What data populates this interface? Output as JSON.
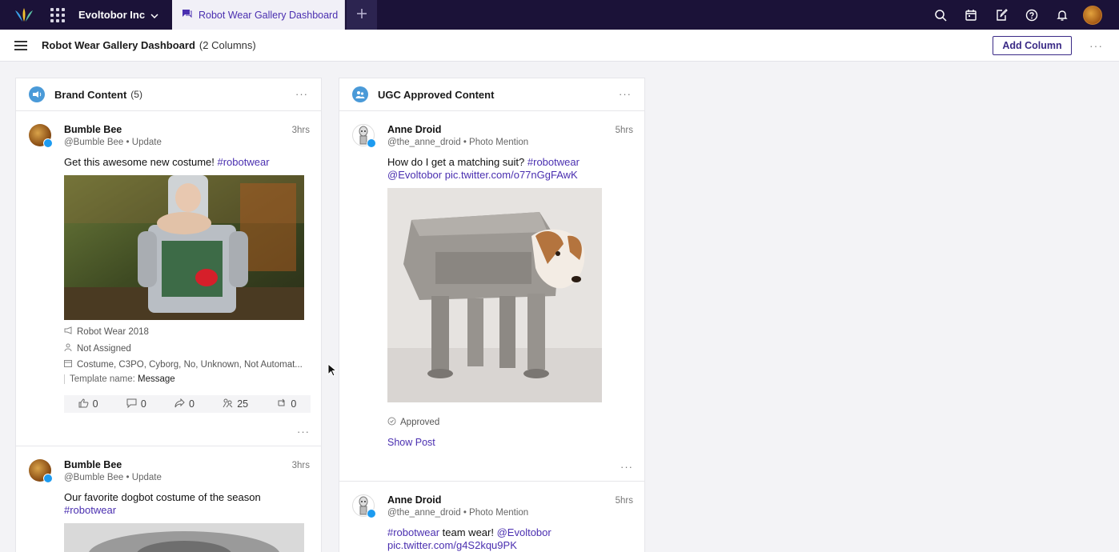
{
  "topbar": {
    "org_name": "Evoltobor Inc",
    "active_tab": "Robot Wear Gallery Dashboard",
    "icons": [
      "logo-icon",
      "apps-grid-icon",
      "chevron-down-icon",
      "chat-icon",
      "plus-icon",
      "search-icon",
      "calendar-icon",
      "compose-icon",
      "help-icon",
      "bell-icon",
      "avatar"
    ]
  },
  "header": {
    "title": "Robot Wear Gallery Dashboard",
    "subtitle": "(2 Columns)",
    "add_column_label": "Add Column",
    "more": "···"
  },
  "columns": [
    {
      "title": "Brand Content",
      "count": "(5)",
      "more": "···",
      "posts": [
        {
          "author": "Bumble Bee",
          "handle": "@Bumble Bee",
          "type": "Update",
          "time": "3hrs",
          "text": "Get this awesome new costume!",
          "hashtag": "#robotwear",
          "campaign": "Robot Wear 2018",
          "assignment": "Not Assigned",
          "tags": "Costume, C3PO, Cyborg, No, Unknown, Not Automat...",
          "template_label": "Template name:",
          "template_value": "Message",
          "stats": {
            "likes": "0",
            "comments": "0",
            "shares": "0",
            "reach": "25",
            "retweets": "0"
          }
        },
        {
          "author": "Bumble Bee",
          "handle": "@Bumble Bee",
          "type": "Update",
          "time": "3hrs",
          "text": "Our favorite dogbot costume of the season",
          "hashtag": "#robotwear"
        }
      ]
    },
    {
      "title": "UGC Approved Content",
      "more": "···",
      "posts": [
        {
          "author": "Anne Droid",
          "handle": "@the_anne_droid",
          "type": "Photo Mention",
          "time": "5hrs",
          "text": "How do I get a matching suit?",
          "hashtag": "#robotwear",
          "mention": "@Evoltobor",
          "url": "pic.twitter.com/o77nGgFAwK",
          "status": "Approved",
          "show_post": "Show Post"
        },
        {
          "author": "Anne Droid",
          "handle": "@the_anne_droid",
          "type": "Photo Mention",
          "time": "5hrs",
          "hashtag": "#robotwear",
          "text": "team wear!",
          "mention": "@Evoltobor",
          "url": "pic.twitter.com/g4S2kqu9PK"
        }
      ]
    }
  ],
  "separator": "•",
  "colors": {
    "topbar": "#1b1238",
    "accent": "#4a2fb0",
    "twitter": "#1d9bf0",
    "column_icon": "#4a9ad8"
  }
}
